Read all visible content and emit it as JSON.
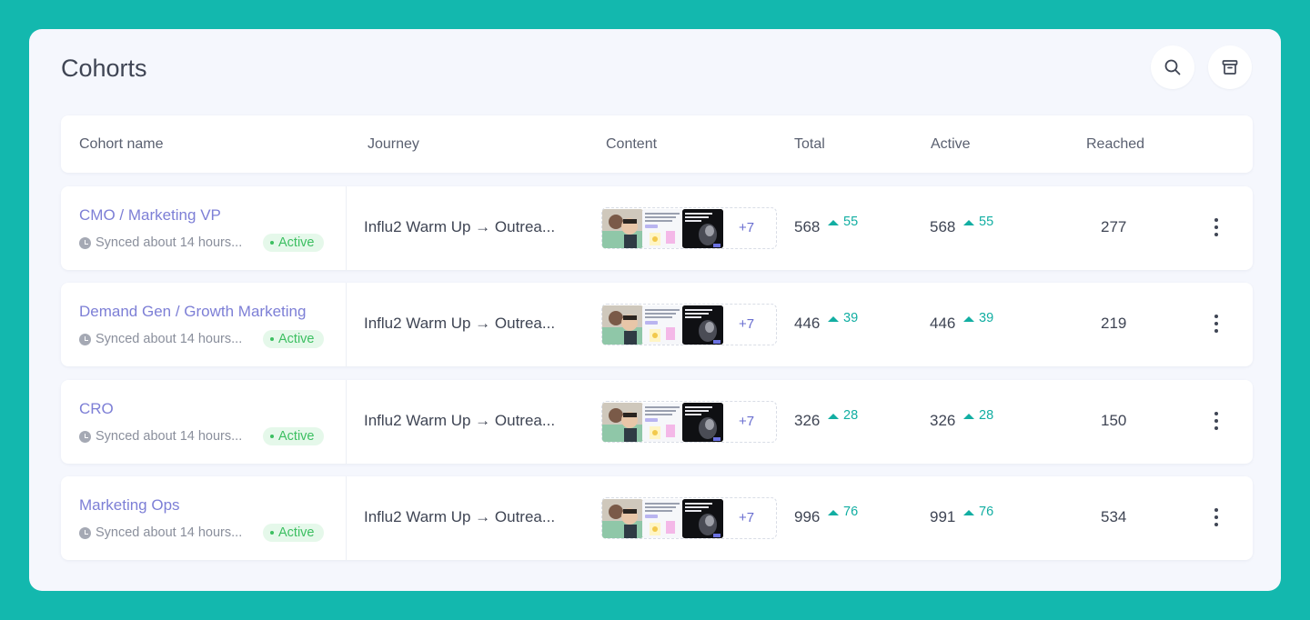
{
  "page": {
    "title": "Cohorts"
  },
  "toolbar": {
    "search_icon": "search-icon",
    "archive_icon": "archive-icon"
  },
  "table": {
    "columns": [
      "Cohort name",
      "Journey",
      "Content",
      "Total",
      "Active",
      "Reached"
    ],
    "rows": [
      {
        "name": "CMO / Marketing VP",
        "sync": "Synced about 14 hours...",
        "status": "Active",
        "journey": "Influ2 Warm Up → Outrea...",
        "more": "+7",
        "total": "568",
        "total_delta": "55",
        "active": "568",
        "active_delta": "55",
        "reached": "277"
      },
      {
        "name": "Demand Gen / Growth Marketing",
        "sync": "Synced about 14 hours...",
        "status": "Active",
        "journey": "Influ2 Warm Up → Outrea...",
        "more": "+7",
        "total": "446",
        "total_delta": "39",
        "active": "446",
        "active_delta": "39",
        "reached": "219"
      },
      {
        "name": "CRO",
        "sync": "Synced about 14 hours...",
        "status": "Active",
        "journey": "Influ2 Warm Up → Outrea...",
        "more": "+7",
        "total": "326",
        "total_delta": "28",
        "active": "326",
        "active_delta": "28",
        "reached": "150"
      },
      {
        "name": "Marketing Ops",
        "sync": "Synced about 14 hours...",
        "status": "Active",
        "journey": "Influ2 Warm Up → Outrea...",
        "more": "+7",
        "total": "996",
        "total_delta": "76",
        "active": "991",
        "active_delta": "76",
        "reached": "534"
      }
    ]
  },
  "colors": {
    "frame": "#13b8ae",
    "panel": "#f5f7fd",
    "link": "#7d7fd6",
    "status_green": "#3cbf61",
    "delta_teal": "#12aea2"
  }
}
